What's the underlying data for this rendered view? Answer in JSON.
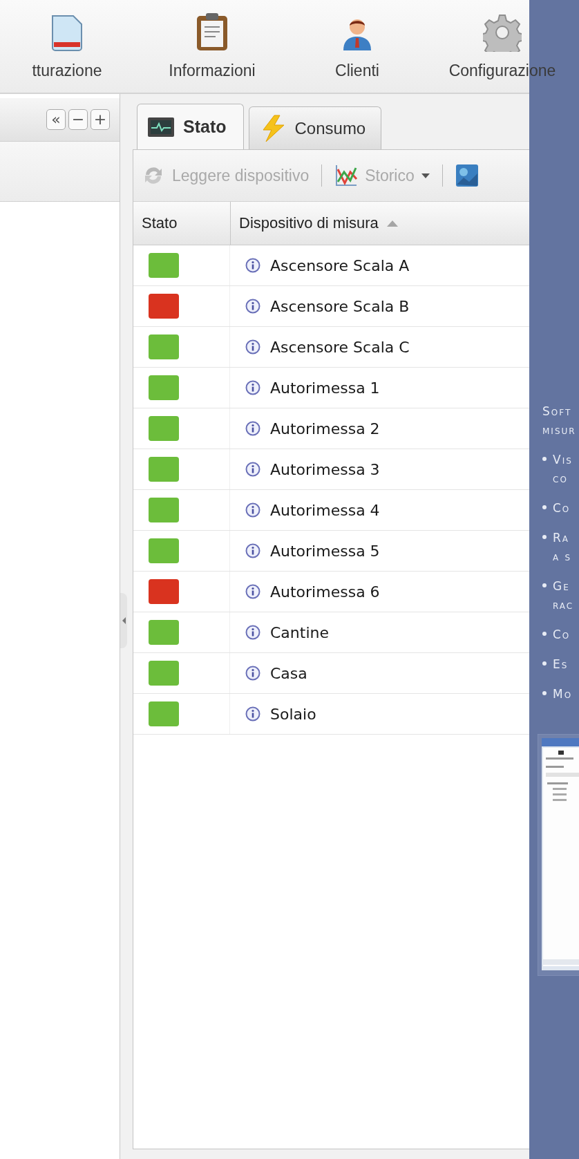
{
  "toolbar": {
    "items": [
      {
        "label": "tturazione",
        "kind": "document"
      },
      {
        "label": "Informazioni",
        "kind": "clipboard"
      },
      {
        "label": "Clienti",
        "kind": "person"
      },
      {
        "label": "Configurazione",
        "kind": "gear"
      }
    ]
  },
  "tree_panel": {
    "buttons": [
      "«",
      "−",
      "+"
    ]
  },
  "tabs": [
    {
      "label": "Stato",
      "selected": true,
      "kind": "monitor"
    },
    {
      "label": "Consumo",
      "selected": false,
      "kind": "bolt"
    }
  ],
  "actions": [
    {
      "label": "Leggere dispositivo",
      "kind": "button",
      "disabled": true
    },
    {
      "label": "Storico",
      "kind": "dropdown",
      "disabled": true
    }
  ],
  "table": {
    "columns": [
      {
        "label": "Stato"
      },
      {
        "label": "Dispositivo di misura",
        "sorted": true
      }
    ],
    "rows": [
      {
        "color": "#6cbd3b",
        "name": "Ascensore Scala A"
      },
      {
        "color": "#d9331f",
        "name": "Ascensore Scala B"
      },
      {
        "color": "#6cbd3b",
        "name": "Ascensore Scala C"
      },
      {
        "color": "#6cbd3b",
        "name": "Autorimessa 1"
      },
      {
        "color": "#6cbd3b",
        "name": "Autorimessa 2"
      },
      {
        "color": "#6cbd3b",
        "name": "Autorimessa 3"
      },
      {
        "color": "#6cbd3b",
        "name": "Autorimessa 4"
      },
      {
        "color": "#6cbd3b",
        "name": "Autorimessa 5"
      },
      {
        "color": "#d9331f",
        "name": "Autorimessa 6"
      },
      {
        "color": "#6cbd3b",
        "name": "Cantine"
      },
      {
        "color": "#6cbd3b",
        "name": "Casa"
      },
      {
        "color": "#6cbd3b",
        "name": "Solaio"
      }
    ]
  },
  "info_panel": {
    "intro": [
      "Soft",
      "misur"
    ],
    "bullets": [
      [
        "Vis",
        "co"
      ],
      [
        "Co"
      ],
      [
        "Ra",
        "a s"
      ],
      [
        "Ge",
        "rac"
      ],
      [
        "Co"
      ],
      [
        "Es"
      ],
      [
        "Mo"
      ]
    ]
  }
}
